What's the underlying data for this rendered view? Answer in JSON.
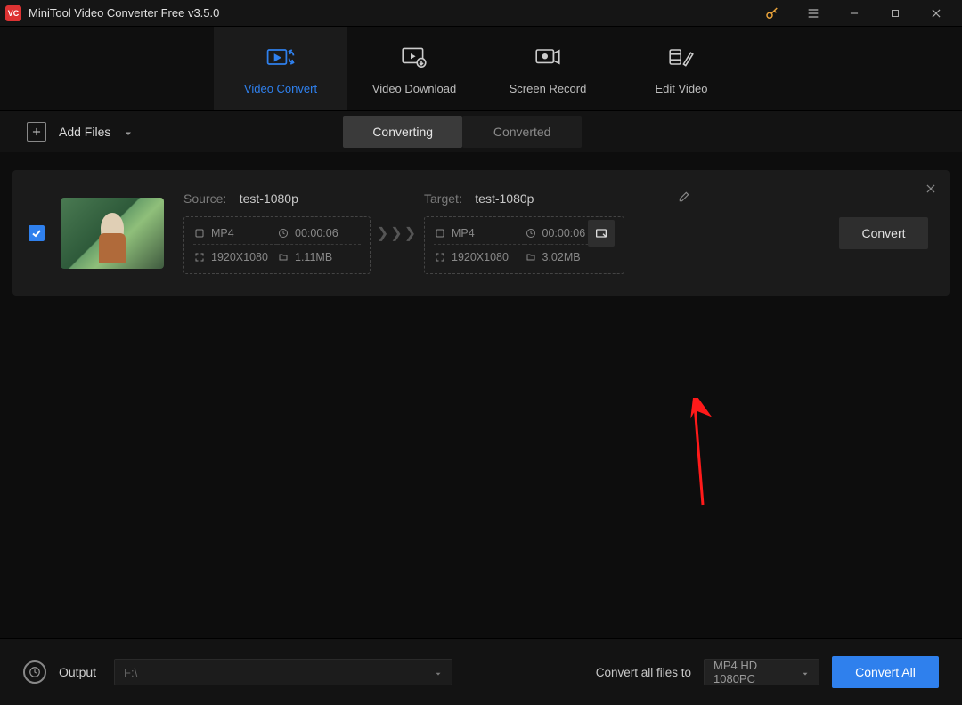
{
  "app": {
    "title": "MiniTool Video Converter Free v3.5.0"
  },
  "tabs": {
    "convert": "Video Convert",
    "download": "Video Download",
    "record": "Screen Record",
    "edit": "Edit Video"
  },
  "toolbar": {
    "add_files": "Add Files"
  },
  "subtabs": {
    "converting": "Converting",
    "converted": "Converted"
  },
  "items": [
    {
      "source": {
        "label": "Source:",
        "name": "test-1080p",
        "format": "MP4",
        "duration": "00:00:06",
        "resolution": "1920X1080",
        "size": "1.11MB"
      },
      "target": {
        "label": "Target:",
        "name": "test-1080p",
        "format": "MP4",
        "duration": "00:00:06",
        "resolution": "1920X1080",
        "size": "3.02MB"
      },
      "convert_label": "Convert"
    }
  ],
  "footer": {
    "output_label": "Output",
    "output_path": "F:\\",
    "convert_all_label": "Convert all files to",
    "format_selected": "MP4 HD 1080PC",
    "convert_all_button": "Convert All"
  }
}
